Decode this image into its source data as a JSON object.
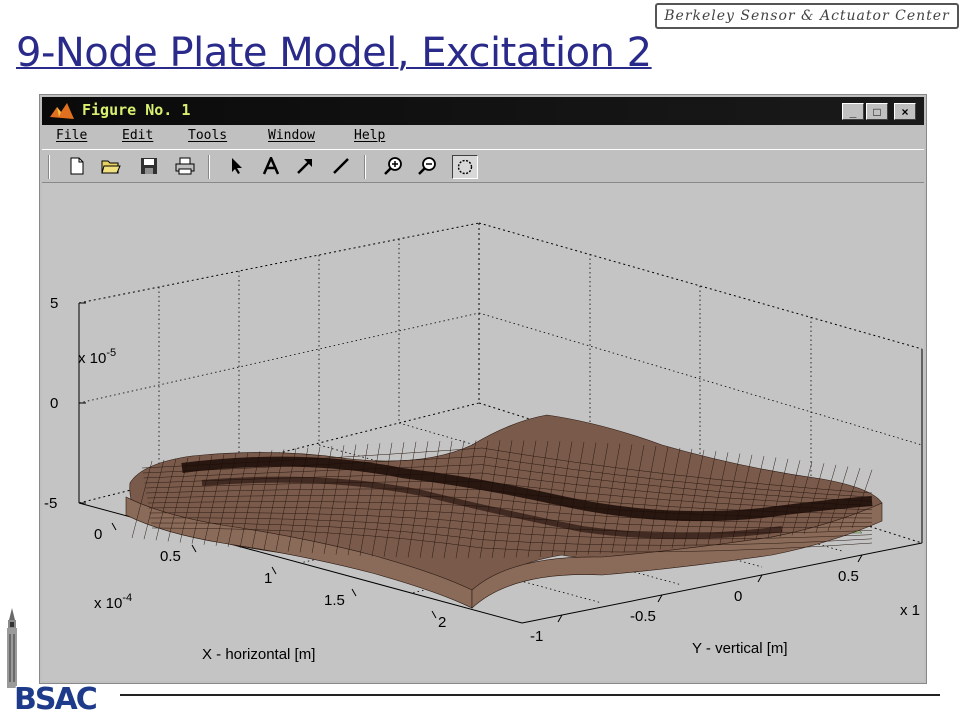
{
  "slide": {
    "title": "9-Node Plate Model, Excitation 2",
    "org_badge": "Berkeley Sensor & Actuator Center",
    "logo": "BSAC"
  },
  "window": {
    "title": "Figure No. 1",
    "controls": [
      "_",
      "□",
      "×"
    ]
  },
  "menu": [
    "File",
    "Edit",
    "Tools",
    "Window",
    "Help"
  ],
  "toolbar": {
    "buttons": [
      "new-file-icon",
      "open-folder-icon",
      "save-icon",
      "print-icon",
      "pointer-icon",
      "text-icon",
      "arrow-icon",
      "line-icon",
      "zoom-in-icon",
      "zoom-out-icon",
      "rotate-icon"
    ],
    "active": "rotate-icon"
  },
  "plot": {
    "type": "3d-surface",
    "surface_color": "#7a5a4a",
    "underside_color": "#a8c890",
    "z_exponent": "x 10",
    "z_exponent_power": "-5",
    "z_ticks": [
      "5",
      "0",
      "-5"
    ],
    "x_exponent": "x 10",
    "x_exponent_power": "-4",
    "x_ticks": [
      "0",
      "0.5",
      "1",
      "1.5",
      "2"
    ],
    "x_label": "X - horizontal  [m]",
    "y_ticks": [
      "-1",
      "-0.5",
      "0",
      "0.5"
    ],
    "y_exponent": "x 1",
    "y_label": "Y - vertical  [m]"
  }
}
